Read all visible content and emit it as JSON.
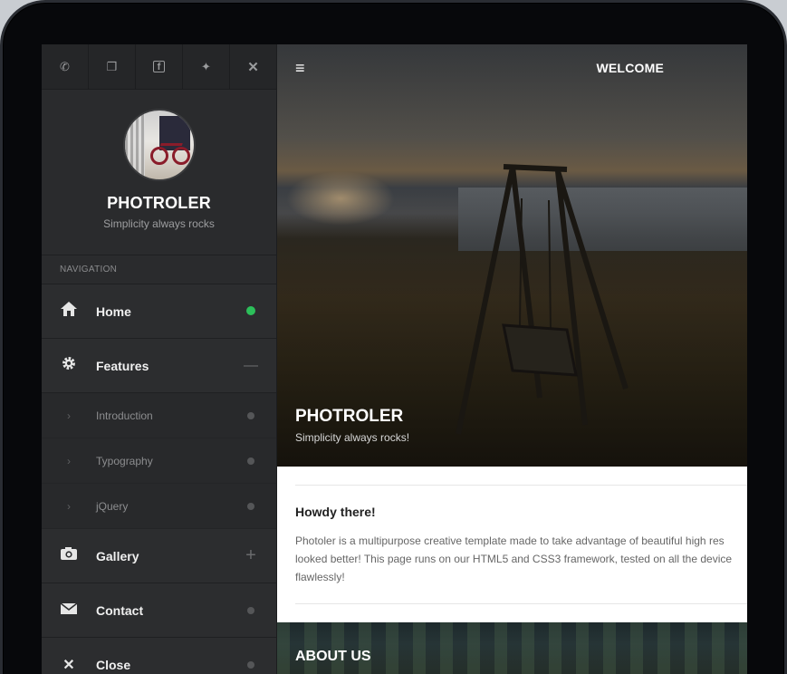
{
  "sidebar": {
    "topbar": {
      "phone": "✆",
      "chat": "❐",
      "facebook": "f",
      "twitter": "✦",
      "close": "✕"
    },
    "profile": {
      "name": "PHOTROLER",
      "tagline": "Simplicity always rocks"
    },
    "nav_label": "NAVIGATION",
    "items": [
      {
        "label": "Home",
        "icon": "home-icon",
        "glyph": "⌂",
        "status": "active"
      },
      {
        "label": "Features",
        "icon": "gear-icon",
        "glyph": "⚙",
        "mark": "—"
      },
      {
        "label": "Introduction",
        "sub": true
      },
      {
        "label": "Typography",
        "sub": true
      },
      {
        "label": "jQuery",
        "sub": true
      },
      {
        "label": "Gallery",
        "icon": "camera-icon",
        "glyph": "◙",
        "mark": "+"
      },
      {
        "label": "Contact",
        "icon": "envelope-icon",
        "glyph": "✉"
      },
      {
        "label": "Close",
        "icon": "close-icon",
        "glyph": "✕"
      }
    ],
    "sub_chevron": "›"
  },
  "main": {
    "menu_glyph": "≡",
    "header_title": "WELCOME",
    "hero": {
      "title": "PHOTROLER",
      "subtitle": "Simplicity always rocks!"
    },
    "card": {
      "heading": "Howdy there!",
      "lines": [
        "Photoler is a multipurpose creative template made to take advantage of beautiful high res",
        "looked better! This page runs on our HTML5 and CSS3 framework, tested on all the device",
        "flawlessly!"
      ]
    },
    "about_title": "ABOUT US"
  },
  "colors": {
    "sidebar_bg": "#2a2b2d",
    "active_dot": "#2cbf5a",
    "bezel": "#07080b"
  }
}
